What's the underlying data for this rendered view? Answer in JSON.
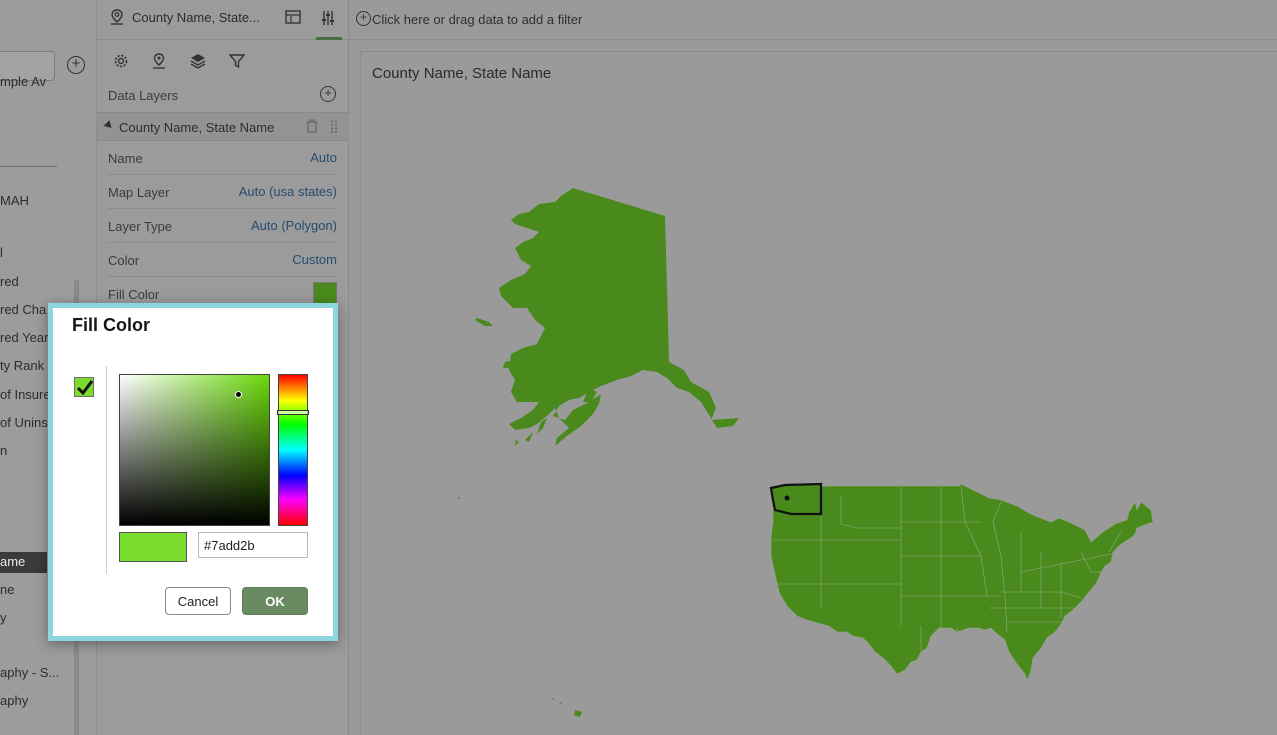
{
  "left_panel": {
    "items": [
      "mple Av",
      "MAH",
      "l",
      "red",
      "red Cha",
      "red Year",
      "ty Rank",
      "of Insure",
      "of Unins",
      "n",
      "ame",
      "ne",
      "y",
      "aphy - S...",
      "aphy"
    ]
  },
  "props_panel": {
    "header_title": "County Name, State...",
    "data_layers_label": "Data Layers",
    "layer_name": "County Name, State Name",
    "rows": [
      {
        "key": "Name",
        "value": "Auto"
      },
      {
        "key": "Map Layer",
        "value": "Auto (usa states)"
      },
      {
        "key": "Layer Type",
        "value": "Auto (Polygon)"
      },
      {
        "key": "Color",
        "value": "Custom"
      },
      {
        "key": "Fill Color",
        "value": ""
      }
    ]
  },
  "filter_bar": {
    "placeholder": "Click here or drag data to add a filter"
  },
  "canvas": {
    "title": "County Name, State Name",
    "fill_color": "#4a8a1c"
  },
  "dialog": {
    "title": "Fill Color",
    "hex_value": "#7add2b",
    "cancel_label": "Cancel",
    "ok_label": "OK",
    "selected_color": "#7add2b"
  },
  "icons": [
    "map-pin-icon",
    "grid-icon",
    "sliders-icon",
    "gear-icon",
    "map-marker-icon",
    "layers-icon",
    "filter-icon",
    "add-circle-icon",
    "trash-icon",
    "drag-handle-icon",
    "checkmark-icon"
  ]
}
